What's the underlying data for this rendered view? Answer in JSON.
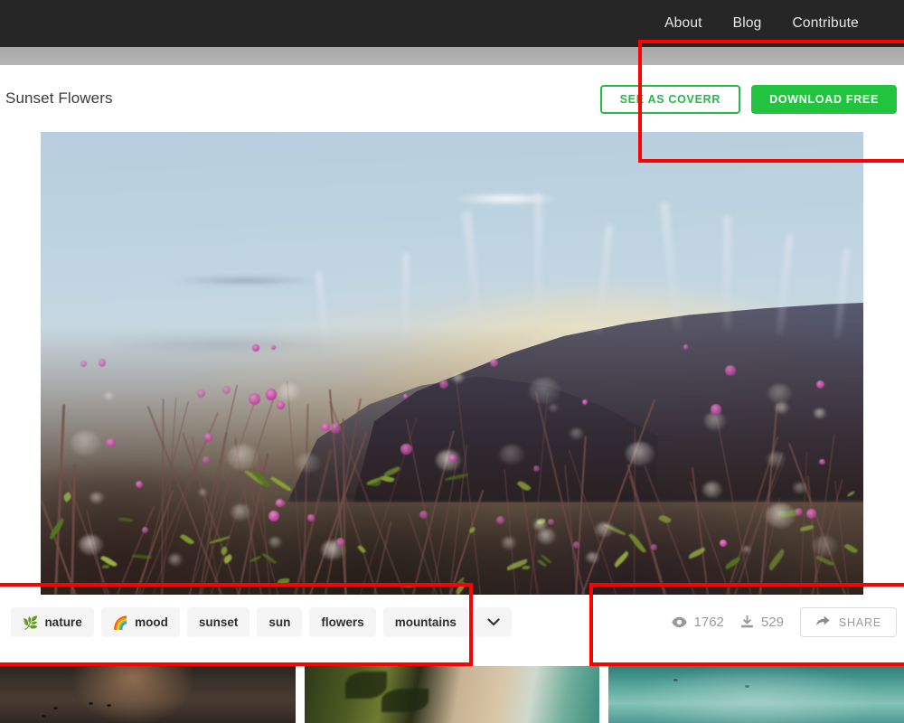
{
  "navbar": {
    "links": [
      {
        "label": "About"
      },
      {
        "label": "Blog"
      },
      {
        "label": "Contribute"
      }
    ]
  },
  "header": {
    "title": "Sunset Flowers",
    "actions": {
      "see_as_coverr_label": "SEE AS COVERR",
      "download_free_label": "DOWNLOAD FREE"
    },
    "colors": {
      "accent_green": "#22c33f",
      "outline_green": "#22bb44",
      "navbar_bg": "#262626",
      "annotation_red": "#ff0000"
    }
  },
  "hero": {
    "alt": "Sunset Flowers",
    "description": "Backlit wildflowers and grasses at sunset with blurred mountain ridge"
  },
  "meta": {
    "tags": [
      {
        "label": "nature",
        "emoji": "🌿",
        "emoji_name": "herb-icon"
      },
      {
        "label": "mood",
        "emoji": "🌈",
        "emoji_name": "rainbow-icon"
      },
      {
        "label": "sunset",
        "emoji": "",
        "emoji_name": ""
      },
      {
        "label": "sun",
        "emoji": "",
        "emoji_name": ""
      },
      {
        "label": "flowers",
        "emoji": "",
        "emoji_name": ""
      },
      {
        "label": "mountains",
        "emoji": "",
        "emoji_name": ""
      }
    ],
    "more_tags_icon": "chevron-down-icon",
    "stats": {
      "views_label": "1762",
      "views_icon": "eye-icon",
      "downloads_label": "529",
      "downloads_icon": "download-icon",
      "share_label": "SHARE",
      "share_icon": "share-arrow-icon"
    }
  },
  "thumbnails": [
    {
      "name": "boats-at-dusk"
    },
    {
      "name": "palm-beach-aerial"
    },
    {
      "name": "turquoise-ocean"
    }
  ],
  "annotations": [
    {
      "name": "actions-highlight"
    },
    {
      "name": "tags-highlight"
    },
    {
      "name": "stats-highlight"
    }
  ]
}
